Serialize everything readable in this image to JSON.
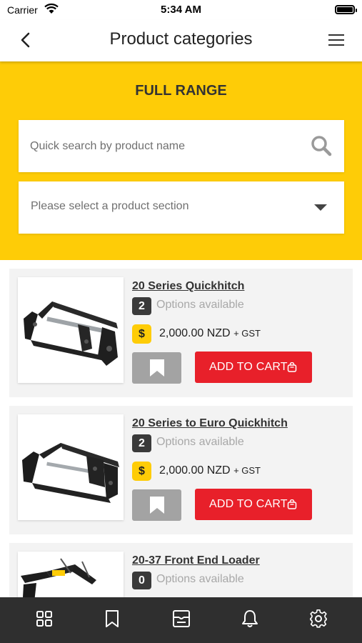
{
  "status_bar": {
    "carrier": "Carrier",
    "time": "5:34 AM",
    "icons": [
      "wifi-icon",
      "battery-icon"
    ]
  },
  "nav": {
    "title": "Product categories",
    "back_icon": "chevron-left-icon",
    "menu_icon": "hamburger-menu-icon"
  },
  "hero": {
    "title": "FULL RANGE",
    "search_placeholder": "Quick search by product name",
    "select_placeholder": "Please select a product section"
  },
  "colors": {
    "accent_yellow": "#fecc07",
    "cart_red": "#e8202a",
    "tab_bar": "#2f2f2f",
    "bookmark_grey": "#a3a3a3"
  },
  "products": [
    {
      "name": "20 Series Quickhitch",
      "options_count": "2",
      "options_label": "Options available",
      "currency_symbol": "$",
      "price": "2,000.00 NZD",
      "tax": "+ GST",
      "cart_label": "ADD TO CART"
    },
    {
      "name": "20 Series to Euro Quickhitch",
      "options_count": "2",
      "options_label": "Options available",
      "currency_symbol": "$",
      "price": "2,000.00 NZD",
      "tax": "+ GST",
      "cart_label": "ADD TO CART"
    },
    {
      "name": "20-37 Front End Loader",
      "options_count": "0",
      "options_label": "Options available"
    }
  ],
  "tab_bar": {
    "icons": [
      "grid-icon",
      "bookmark-icon",
      "catalog-icon",
      "bell-icon",
      "gear-icon"
    ]
  }
}
